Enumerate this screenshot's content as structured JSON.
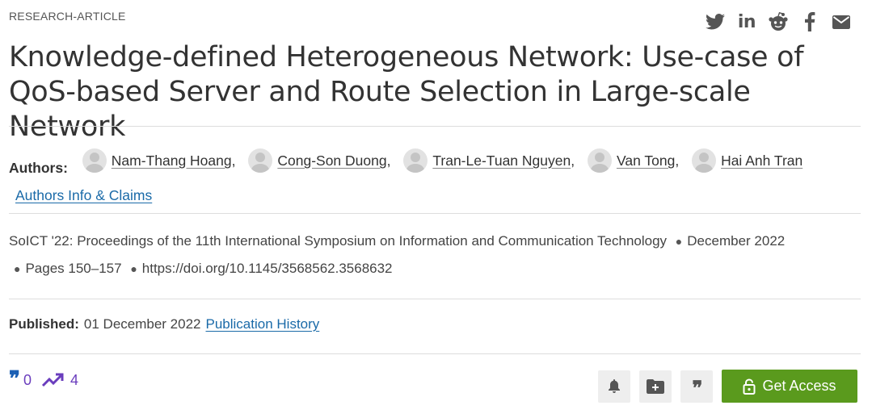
{
  "article": {
    "type_label": "RESEARCH-ARTICLE",
    "title": "Knowledge-defined Heterogeneous Network: Use-case of QoS-based Server and Route Selection in Large-scale Network"
  },
  "share": {
    "icons": [
      "twitter-icon",
      "linkedin-icon",
      "reddit-icon",
      "facebook-icon",
      "email-icon"
    ],
    "linkedin_text": "in"
  },
  "authors": {
    "label": "Authors:",
    "list": [
      {
        "name": "Nam-Thang Hoang",
        "sep": ","
      },
      {
        "name": "Cong-Son Duong",
        "sep": ","
      },
      {
        "name": "Tran-Le-Tuan Nguyen",
        "sep": ","
      },
      {
        "name": "Van Tong",
        "sep": ","
      },
      {
        "name": "Hai Anh Tran",
        "sep": ""
      }
    ],
    "info_link": "Authors Info & Claims"
  },
  "proceedings": {
    "venue": "SoICT '22: Proceedings of the 11th International Symposium on Information and Communication Technology",
    "date": "December 2022",
    "pages": "Pages 150–157",
    "doi": "https://doi.org/10.1145/3568562.3568632",
    "bullet": "●"
  },
  "published": {
    "label": "Published:",
    "date": "01 December 2022",
    "history_link": "Publication History"
  },
  "metrics": {
    "citations": "0",
    "downloads": "4",
    "cite_glyph": "❞"
  },
  "actions": {
    "quote_glyph": "❞",
    "get_access": "Get Access"
  },
  "colors": {
    "link": "#1a6aa8",
    "access_button": "#5a9a1d",
    "metric": "#6a3dbd",
    "cite_icon": "#1a5fb4"
  }
}
